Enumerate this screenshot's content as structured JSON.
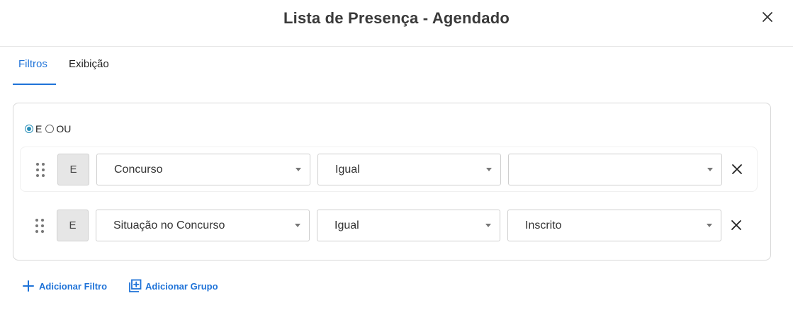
{
  "dialog": {
    "title": "Lista de Presença - Agendado"
  },
  "tabs": [
    {
      "label": "Filtros",
      "active": true
    },
    {
      "label": "Exibição",
      "active": false
    }
  ],
  "logic": {
    "options": [
      "E",
      "OU"
    ],
    "selected": "E"
  },
  "filters": [
    {
      "operator_badge": "E",
      "field": "Concurso",
      "comparison": "Igual",
      "value": ""
    },
    {
      "operator_badge": "E",
      "field": "Situação no Concurso",
      "comparison": "Igual",
      "value": "Inscrito"
    }
  ],
  "actions": {
    "add_filter": "Adicionar Filtro",
    "add_group": "Adicionar Grupo"
  },
  "icons": {
    "close": "close-icon",
    "drag": "drag-handle-icon",
    "caret": "chevron-down-icon",
    "remove": "remove-icon",
    "plus": "plus-icon",
    "add_group": "add-group-icon"
  },
  "colors": {
    "accent": "#1f73d8",
    "radio_checked": "#2a8fb8"
  }
}
